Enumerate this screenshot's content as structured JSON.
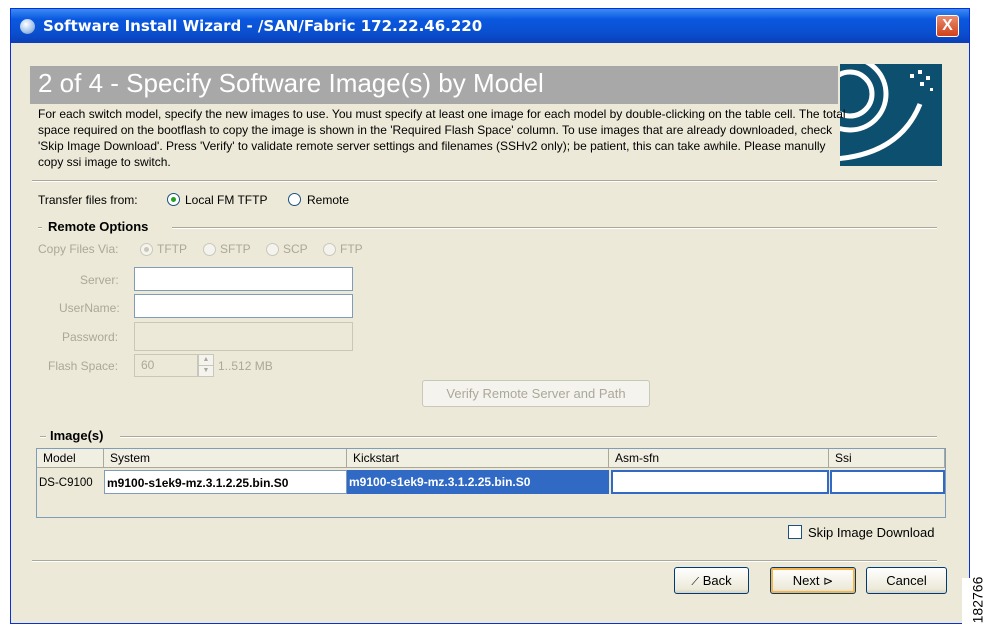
{
  "window": {
    "title": "Software Install Wizard - /SAN/Fabric 172.22.46.220",
    "close_label": "X"
  },
  "header": {
    "step_title": "2 of 4 - Specify Software Image(s) by Model",
    "description": "For each switch model, specify the new images to use. You must specify at least one image for each model by double-clicking on the table cell.  The total space required on the bootflash to copy the image is shown in the 'Required Flash Space' column.  To use images that are already downloaded, check 'Skip Image Download'. Press 'Verify' to validate remote server settings and filenames (SSHv2 only); be patient, this can take awhile. Please manully copy ssi image to switch."
  },
  "transfer": {
    "label": "Transfer files from:",
    "options": [
      {
        "label": "Local FM TFTP",
        "selected": true
      },
      {
        "label": "Remote",
        "selected": false
      }
    ]
  },
  "remote_options": {
    "title": "Remote Options",
    "copy_via_label": "Copy Files Via:",
    "copy_via_options": [
      {
        "label": "TFTP",
        "selected": true
      },
      {
        "label": "SFTP",
        "selected": false
      },
      {
        "label": "SCP",
        "selected": false
      },
      {
        "label": "FTP",
        "selected": false
      }
    ],
    "server_label": "Server:",
    "server_value": "",
    "username_label": "UserName:",
    "username_value": "",
    "password_label": "Password:",
    "password_value": "",
    "flash_label": "Flash Space:",
    "flash_value": "60",
    "flash_range": "1..512 MB",
    "verify_button": "Verify Remote Server and Path"
  },
  "images": {
    "title": "Image(s)",
    "columns": [
      "Model",
      "System",
      "Kickstart",
      "Asm-sfn",
      "Ssi"
    ],
    "rows": [
      {
        "model": "DS-C9100",
        "system": "m9100-s1ek9-mz.3.1.2.25.bin.S0",
        "kickstart": "m9100-s1ek9-mz.3.1.2.25.bin.S0",
        "asm_sfn": "",
        "ssi": ""
      }
    ],
    "skip_label": "Skip Image Download",
    "skip_checked": false
  },
  "footer": {
    "back": "Back",
    "next": "Next",
    "cancel": "Cancel"
  },
  "side_stamp": "182766",
  "colors": {
    "title_blue": "#0a58e0",
    "selection_blue": "#316ac5",
    "radio_green": "#21a121",
    "header_gray": "#a8a8a8",
    "logo_teal": "#0d4f6e"
  }
}
